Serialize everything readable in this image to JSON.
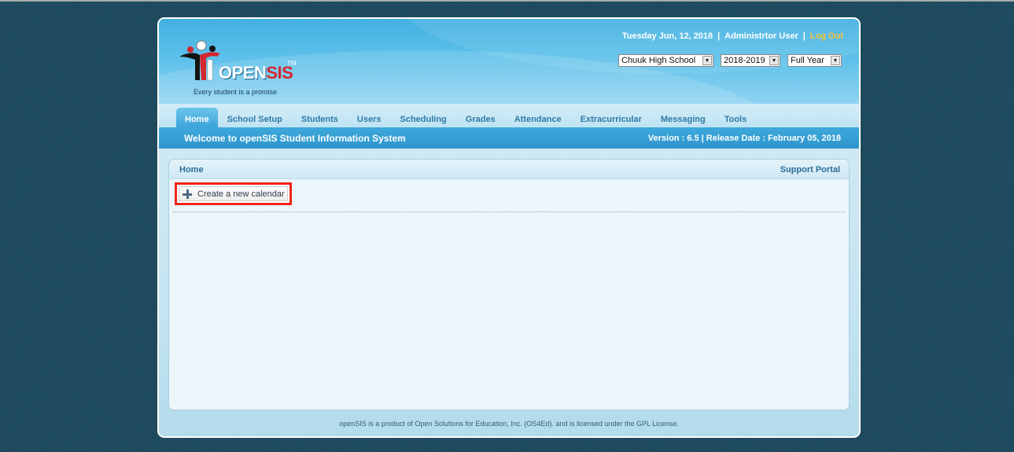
{
  "header": {
    "logo": {
      "brand_open": "OPEN",
      "brand_sis": "SIS",
      "tm": "TM",
      "tagline": "Every student is a promise"
    },
    "date": "Tuesday Jun, 12, 2018",
    "separator": "|",
    "user": "Administrtor User",
    "logout": "Log Out",
    "school_select": {
      "value": "Chuuk High School"
    },
    "year_select": {
      "value": "2018-2019"
    },
    "period_select": {
      "value": "Full Year"
    }
  },
  "nav": {
    "tabs": [
      {
        "label": "Home",
        "active": true
      },
      {
        "label": "School Setup"
      },
      {
        "label": "Students"
      },
      {
        "label": "Users"
      },
      {
        "label": "Scheduling"
      },
      {
        "label": "Grades"
      },
      {
        "label": "Attendance"
      },
      {
        "label": "Extracurricular"
      },
      {
        "label": "Messaging"
      },
      {
        "label": "Tools"
      }
    ]
  },
  "welcome": {
    "title": "Welcome to openSIS Student Information System",
    "version": "Version : 6.5 | Release Date : February 05, 2018"
  },
  "panel": {
    "breadcrumb": "Home",
    "support_link": "Support Portal",
    "create_button": "Create a new calendar"
  },
  "footer": {
    "text": "openSIS is a product of Open Solutions for Education, Inc. (OS4Ed). and is licensed under the GPL License."
  },
  "colors": {
    "accent": "#3ba4d8",
    "highlight_border": "#f0241a",
    "logout": "#f6c13a",
    "background": "#1d4a5e"
  }
}
